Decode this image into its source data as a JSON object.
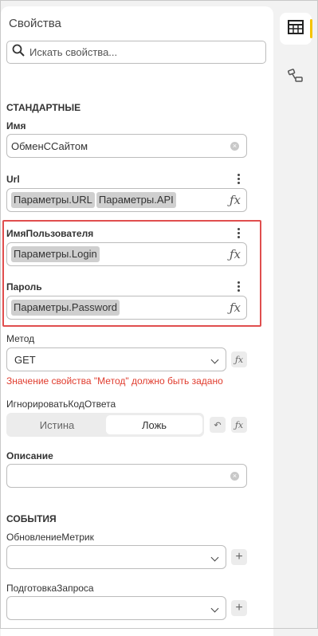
{
  "header": {
    "title": "Свойства"
  },
  "search": {
    "placeholder": "Искать свойства..."
  },
  "sections": {
    "standard": "СТАНДАРТНЫЕ",
    "events": "СОБЫТИЯ"
  },
  "props": {
    "name": {
      "label": "Имя",
      "value": "ОбменССайтом"
    },
    "url": {
      "label": "Url",
      "chips": [
        "Параметры.URL",
        "Параметры.API"
      ]
    },
    "username": {
      "label": "ИмяПользователя",
      "chips": [
        "Параметры.Login"
      ]
    },
    "password": {
      "label": "Пароль",
      "chips": [
        "Параметры.Password"
      ]
    },
    "method": {
      "label": "Метод",
      "value": "GET",
      "error": "Значение свойства \"Метод\" должно быть задано"
    },
    "ignore_code": {
      "label": "ИгнорироватьКодОтвета",
      "options": [
        "Истина",
        "Ложь"
      ],
      "selected": "Ложь"
    },
    "description": {
      "label": "Описание",
      "value": ""
    }
  },
  "events": {
    "metrics_update": {
      "label": "ОбновлениеМетрик",
      "value": ""
    },
    "request_prepare": {
      "label": "ПодготовкаЗапроса",
      "value": ""
    }
  },
  "icons": {
    "fx": "ƒx",
    "clear": "×",
    "plus": "+",
    "reset": "↶"
  },
  "colors": {
    "accent": "#f5c400",
    "error": "#e03c2e",
    "highlight_border": "#e04e4e"
  }
}
